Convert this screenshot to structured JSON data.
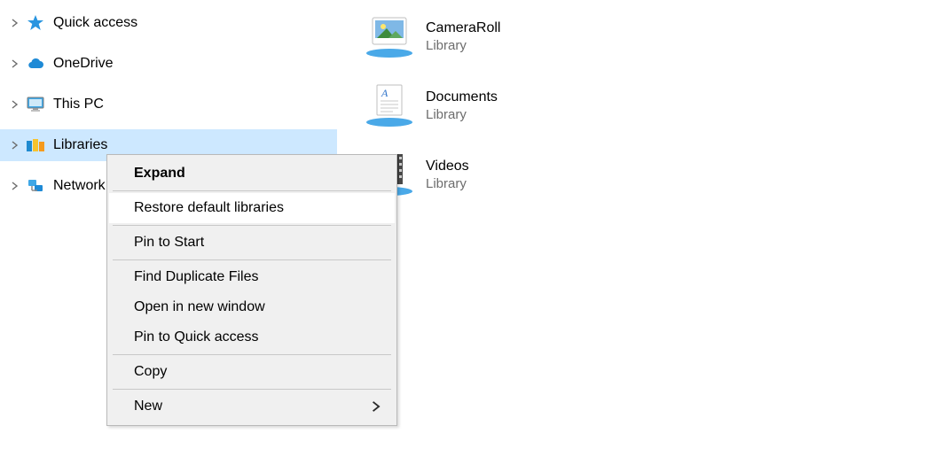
{
  "nav": {
    "items": [
      {
        "label": "Quick access",
        "icon": "star"
      },
      {
        "label": "OneDrive",
        "icon": "cloud"
      },
      {
        "label": "This PC",
        "icon": "pc"
      },
      {
        "label": "Libraries",
        "icon": "libraries",
        "selected": true
      },
      {
        "label": "Network",
        "icon": "network"
      }
    ]
  },
  "libraries": {
    "subtitle": "Library",
    "items": [
      {
        "name": "CameraRoll",
        "icon": "pictures"
      },
      {
        "name": "Documents",
        "icon": "documents"
      },
      {
        "name": "Videos",
        "icon": "videos"
      }
    ]
  },
  "context_menu": {
    "groups": [
      [
        {
          "label": "Expand",
          "default": true
        }
      ],
      [
        {
          "label": "Restore default libraries",
          "hover": true
        }
      ],
      [
        {
          "label": "Pin to Start"
        }
      ],
      [
        {
          "label": "Find Duplicate Files"
        },
        {
          "label": "Open in new window"
        },
        {
          "label": "Pin to Quick access"
        }
      ],
      [
        {
          "label": "Copy"
        }
      ],
      [
        {
          "label": "New",
          "submenu": true
        }
      ]
    ]
  }
}
